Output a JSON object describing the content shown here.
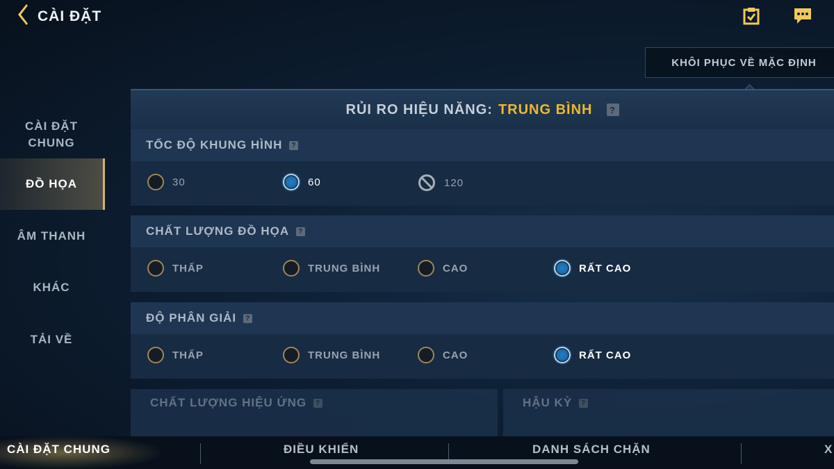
{
  "header": {
    "title": "CÀI ĐẶT",
    "icons": [
      "back-arrow-icon",
      "checklist-icon",
      "chat-icon"
    ],
    "reset_label": "KHÔI PHỤC VỀ MẶC ĐỊNH"
  },
  "sidebar": {
    "items": [
      {
        "label": "CÀI ĐẶT\nCHUNG",
        "active": false
      },
      {
        "label": "ĐỒ HỌA",
        "active": true
      },
      {
        "label": "ÂM THANH",
        "active": false
      },
      {
        "label": "KHÁC",
        "active": false
      },
      {
        "label": "TẢI VỀ",
        "active": false
      }
    ]
  },
  "risk": {
    "label": "RỦI RO HIỆU NĂNG:",
    "value": "TRUNG BÌNH",
    "help": "?"
  },
  "sections": {
    "frame_rate": {
      "title": "TỐC ĐỘ KHUNG HÌNH",
      "help": "?",
      "options": [
        "30",
        "60",
        "120"
      ],
      "selected": "60",
      "disabled": [
        "120"
      ]
    },
    "graphics_quality": {
      "title": "CHẤT LƯỢNG ĐỒ HỌA",
      "help": "?",
      "options": [
        "THẤP",
        "TRUNG BÌNH",
        "CAO",
        "RẤT CAO"
      ],
      "selected": "RẤT CAO"
    },
    "resolution": {
      "title": "ĐỘ PHÂN GIẢI",
      "help": "?",
      "options": [
        "THẤP",
        "TRUNG BÌNH",
        "CAO",
        "RẤT CAO"
      ],
      "selected": "RẤT CAO"
    },
    "effects_quality": {
      "title": "CHẤT LƯỢNG HIỆU ỨNG",
      "help": "?"
    },
    "post_processing": {
      "title": "HẬU KỲ",
      "help": "?"
    }
  },
  "bottom_tabs": [
    {
      "label": "CÀI ĐẶT CHUNG",
      "active": true
    },
    {
      "label": "ĐIỀU KHIỂN",
      "active": false
    },
    {
      "label": "DANH SÁCH CHẶN",
      "active": false
    },
    {
      "label": "X",
      "active": false
    }
  ],
  "colors": {
    "accent_gold": "#f0b72e",
    "active_border": "#d4b46a",
    "radio_selected": "#1d7fc9"
  }
}
